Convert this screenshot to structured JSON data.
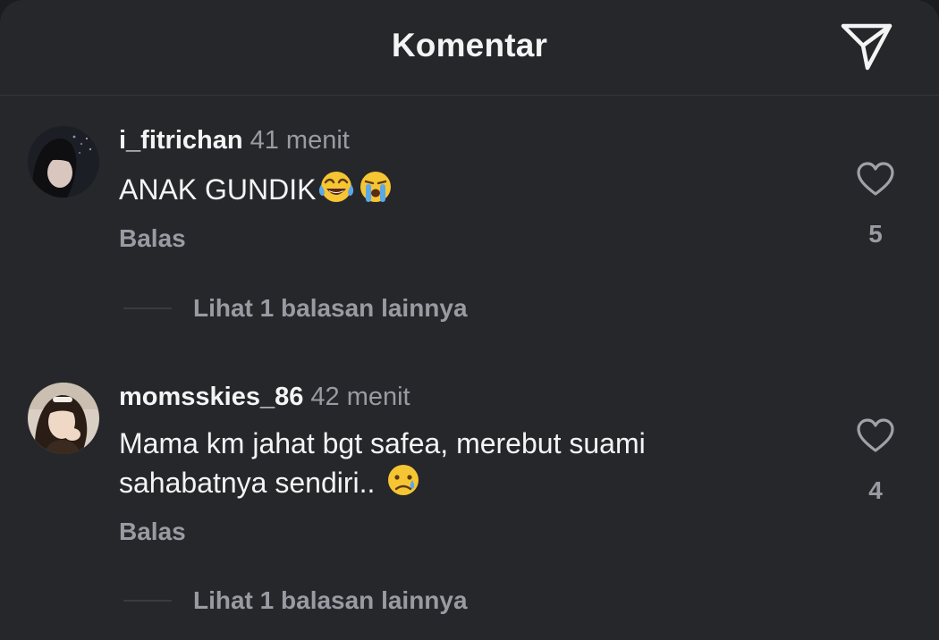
{
  "header": {
    "title": "Komentar",
    "share_icon": "paper-plane-icon"
  },
  "comments": [
    {
      "username": "i_fitrichan",
      "time": "41 menit",
      "text": "ANAK GUNDIK",
      "emojis": [
        "😂",
        "😭"
      ],
      "reply_label": "Balas",
      "likes": "5",
      "view_replies": "Lihat 1 balasan lainnya"
    },
    {
      "username": "momsskies_86",
      "time": "42 menit",
      "text_line1": "Mama km jahat bgt safea, merebut suami",
      "text_line2": "sahabatnya sendiri..",
      "emojis": [
        "😢"
      ],
      "reply_label": "Balas",
      "likes": "4",
      "view_replies": "Lihat 1 balasan lainnya"
    }
  ],
  "colors": {
    "background": "#26272b",
    "text_primary": "#f4f4f5",
    "text_secondary": "#9a9ba2",
    "divider": "#34353a"
  }
}
